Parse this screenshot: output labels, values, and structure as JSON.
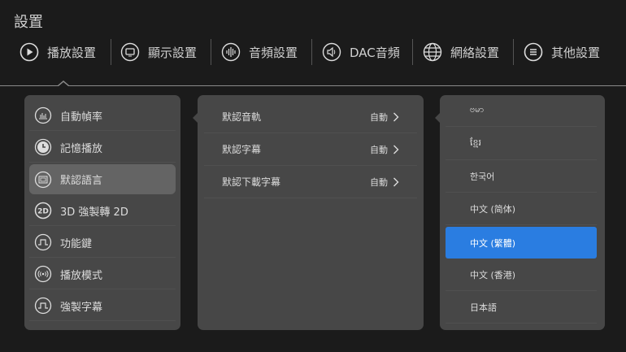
{
  "header": {
    "title": "設置"
  },
  "nav": [
    {
      "label": "播放設置",
      "icon": "play-icon"
    },
    {
      "label": "顯示設置",
      "icon": "monitor-icon"
    },
    {
      "label": "音頻設置",
      "icon": "audio-wave-icon"
    },
    {
      "label": "DAC音頻",
      "icon": "speaker-icon"
    },
    {
      "label": "網絡設置",
      "icon": "globe-icon"
    },
    {
      "label": "其他設置",
      "icon": "menu-icon"
    }
  ],
  "left_menu": [
    {
      "label": "自動幀率",
      "icon": "bar-chart-icon"
    },
    {
      "label": "記憶播放",
      "icon": "clock-icon"
    },
    {
      "label": "默認語言",
      "icon": "language-icon",
      "selected": true
    },
    {
      "label": "3D 強製轉 2D",
      "icon": "2d-icon"
    },
    {
      "label": "功能鍵",
      "icon": "pulse-icon"
    },
    {
      "label": "播放模式",
      "icon": "broadcast-icon"
    },
    {
      "label": "強製字幕",
      "icon": "pulse-icon"
    }
  ],
  "middle_menu": [
    {
      "label": "默認音軌",
      "value": "自動"
    },
    {
      "label": "默認字幕",
      "value": "自動"
    },
    {
      "label": "默認下載字幕",
      "value": "自動"
    }
  ],
  "languages": [
    {
      "label": "ဗမာ"
    },
    {
      "label": "ខ្មែរ"
    },
    {
      "label": "한국어"
    },
    {
      "label": "中文 (简体)"
    },
    {
      "label": "中文 (繁體)",
      "selected": true
    },
    {
      "label": "中文 (香港)"
    },
    {
      "label": "日本語"
    }
  ],
  "colors": {
    "accent": "#2a7de1",
    "panel": "#474747",
    "background": "#1b1b1b"
  }
}
